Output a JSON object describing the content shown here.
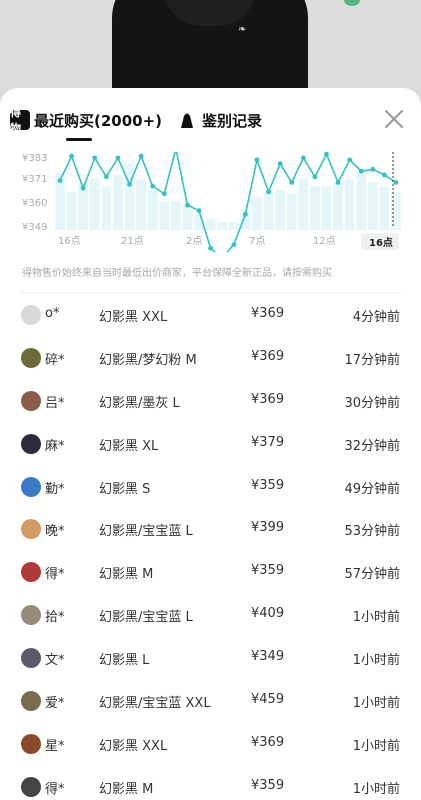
{
  "tabs": {
    "logo_text": "得物",
    "recent_label": "最近购买(2000+)",
    "auth_label": "鉴别记录"
  },
  "chart_data": {
    "type": "line",
    "y_ticks": [
      "¥383",
      "¥371",
      "¥360",
      "¥349"
    ],
    "x_ticks": [
      "16点",
      "21点",
      "2点",
      "7点",
      "12点",
      "16点"
    ],
    "selected_x": "16点",
    "ylim": [
      349,
      383
    ],
    "values": [
      371,
      384,
      367,
      383,
      373,
      383,
      369,
      384,
      368,
      364,
      388,
      358,
      355,
      335,
      330,
      337,
      353,
      382,
      365,
      380,
      370,
      383,
      373,
      385,
      370,
      382,
      376,
      377,
      374,
      370
    ],
    "bar_values": [
      375,
      365,
      370,
      372,
      368,
      374,
      380,
      372,
      366,
      360,
      360,
      358,
      353,
      351,
      349,
      349,
      355,
      362,
      365,
      366,
      364,
      372,
      368,
      368,
      370,
      372,
      376,
      370,
      368,
      365
    ],
    "colors": {
      "line": "#33c2c2",
      "bar": "#e4f6f8",
      "axis_text": "#aaaaaa"
    }
  },
  "note": "得物售价始终来自当时最低出价商家，平台保障全新正品，请按需购买",
  "purchases": [
    {
      "buyer": "o*",
      "variant": "幻影黑 XXL",
      "price": "¥369",
      "time": "4分钟前",
      "avatar": "#d8d8d8"
    },
    {
      "buyer": "碎*",
      "variant": "幻影黑/梦幻粉 M",
      "price": "¥369",
      "time": "17分钟前",
      "avatar": "#6b6b3a"
    },
    {
      "buyer": "吕*",
      "variant": "幻影黑/墨灰 L",
      "price": "¥369",
      "time": "30分钟前",
      "avatar": "#8a5c4a"
    },
    {
      "buyer": "麻*",
      "variant": "幻影黑 XL",
      "price": "¥379",
      "time": "32分钟前",
      "avatar": "#2d2a3a"
    },
    {
      "buyer": "勤*",
      "variant": "幻影黑 S",
      "price": "¥359",
      "time": "49分钟前",
      "avatar": "#3a7bc8"
    },
    {
      "buyer": "晚*",
      "variant": "幻影黑/宝宝蓝 L",
      "price": "¥399",
      "time": "53分钟前",
      "avatar": "#d49a63"
    },
    {
      "buyer": "得*",
      "variant": "幻影黑 M",
      "price": "¥359",
      "time": "57分钟前",
      "avatar": "#b03a3a"
    },
    {
      "buyer": "拾*",
      "variant": "幻影黑/宝宝蓝 L",
      "price": "¥409",
      "time": "1小时前",
      "avatar": "#9a8a7a"
    },
    {
      "buyer": "文*",
      "variant": "幻影黑 L",
      "price": "¥349",
      "time": "1小时前",
      "avatar": "#5a5a6a"
    },
    {
      "buyer": "爱*",
      "variant": "幻影黑/宝宝蓝 XXL",
      "price": "¥459",
      "time": "1小时前",
      "avatar": "#7a6a50"
    },
    {
      "buyer": "星*",
      "variant": "幻影黑 XXL",
      "price": "¥369",
      "time": "1小时前",
      "avatar": "#8a4a2a"
    },
    {
      "buyer": "得*",
      "variant": "幻影黑 M",
      "price": "¥359",
      "time": "1小时前",
      "avatar": "#444444"
    }
  ]
}
